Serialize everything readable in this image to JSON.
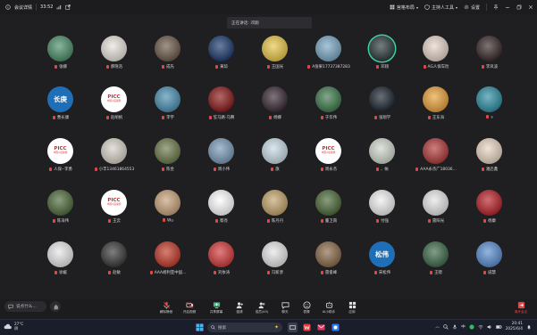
{
  "window": {
    "title": "会议详情",
    "time": "33:52",
    "network_icon": "signal-bars-icon",
    "share_icon": "external-link-icon",
    "view_menu": "宫格布局",
    "host_tools": "主持人工具",
    "settings": "设置"
  },
  "speaking_banner": "正在讲话: 邓翔",
  "participants": [
    {
      "name": "张娜",
      "bg": "#4b8e6a",
      "kind": "photo"
    },
    {
      "name": "郝晓浩",
      "bg": "#e8e3dc",
      "kind": "photo"
    },
    {
      "name": "成先",
      "bg": "#6d5a4a",
      "kind": "photo"
    },
    {
      "name": "黄琼",
      "bg": "#1d3a6e",
      "kind": "photo"
    },
    {
      "name": "王国光",
      "bg": "#e8c74a",
      "kind": "photo"
    },
    {
      "name": "A张果17737387283",
      "bg": "#7aa7c4",
      "kind": "photo"
    },
    {
      "name": "邓翔",
      "bg": "#2c3a3c",
      "kind": "photo",
      "active": true
    },
    {
      "name": "AG人保车险",
      "bg": "#e6d4c8",
      "kind": "photo"
    },
    {
      "name": "李凤波",
      "bg": "#3a2a2a",
      "kind": "photo"
    },
    {
      "name": "曹长康",
      "bg": "#1f6fb8",
      "kind": "text",
      "text": "长庚"
    },
    {
      "name": "赵胡帆",
      "bg": "#ffffff",
      "kind": "logo",
      "text": "PICC",
      "sub": "中国人民保险"
    },
    {
      "name": "李宇",
      "bg": "#4a8fb2",
      "kind": "photo"
    },
    {
      "name": "笙马路-马腾",
      "bg": "#8a1a1a",
      "kind": "photo"
    },
    {
      "name": "杨娜",
      "bg": "#3a2b36",
      "kind": "photo"
    },
    {
      "name": "于华伟",
      "bg": "#3e7a4c",
      "kind": "photo"
    },
    {
      "name": "张翔学",
      "bg": "#1c2430",
      "kind": "photo"
    },
    {
      "name": "王东海",
      "bg": "#e8a23a",
      "kind": "photo"
    },
    {
      "name": "s",
      "bg": "#2e8ea4",
      "kind": "photo"
    },
    {
      "name": "人保--李勇",
      "bg": "#ffffff",
      "kind": "logo",
      "text": "PICC",
      "sub": "中国人民保险"
    },
    {
      "name": "小丰13461864553",
      "bg": "#d8d2c8",
      "kind": "photo"
    },
    {
      "name": "陈金",
      "bg": "#6c7a4c",
      "kind": "photo"
    },
    {
      "name": "周小伟",
      "bg": "#7a9ab8",
      "kind": "photo"
    },
    {
      "name": "旗",
      "bg": "#c8dbe6",
      "kind": "photo"
    },
    {
      "name": "周永杰",
      "bg": "#ffffff",
      "kind": "logo",
      "text": "PICC",
      "sub": "中国人民保险"
    },
    {
      "name": "、帐",
      "bg": "#cfd8cc",
      "kind": "photo"
    },
    {
      "name": "AAA永杰广18036...",
      "bg": "#b23a3a",
      "kind": "photo"
    },
    {
      "name": "潘启鑫",
      "bg": "#e9d6c2",
      "kind": "photo"
    },
    {
      "name": "陈海伟",
      "bg": "#4f6b3c",
      "kind": "photo"
    },
    {
      "name": "王云",
      "bg": "#ffffff",
      "kind": "logo",
      "text": "PICC",
      "sub": "中国人民保险"
    },
    {
      "name": "Wu",
      "bg": "#c8a27a",
      "kind": "photo"
    },
    {
      "name": "蔡亮",
      "bg": "#ffffff",
      "kind": "photo"
    },
    {
      "name": "陈丹丹",
      "bg": "#c4a46c",
      "kind": "photo"
    },
    {
      "name": "董卫南",
      "bg": "#4c6a3a",
      "kind": "photo"
    },
    {
      "name": "付强",
      "bg": "#f0f0f0",
      "kind": "photo"
    },
    {
      "name": "雷阳光",
      "bg": "#e6e6e6",
      "kind": "photo"
    },
    {
      "name": "杨康",
      "bg": "#b8222a",
      "kind": "photo"
    },
    {
      "name": "徐媛",
      "bg": "#e8e8e8",
      "kind": "photo"
    },
    {
      "name": "赵敏",
      "bg": "#3a3a3a",
      "kind": "photo"
    },
    {
      "name": "AAA胡利亚中国...",
      "bg": "#c23a2a",
      "kind": "photo"
    },
    {
      "name": "刘依涛",
      "bg": "#d23a3a",
      "kind": "photo"
    },
    {
      "name": "冯新彦",
      "bg": "#e6e6e6",
      "kind": "photo"
    },
    {
      "name": "雷俊峰",
      "bg": "#8a6a4a",
      "kind": "photo"
    },
    {
      "name": "宋松伟",
      "bg": "#1f6fb8",
      "kind": "text",
      "text": "松伟"
    },
    {
      "name": "王嗯",
      "bg": "#3e6a4a",
      "kind": "photo"
    },
    {
      "name": "戚慧",
      "bg": "#5a8ed0",
      "kind": "photo"
    }
  ],
  "meeting_bar": {
    "chat_placeholder": "说点什么...",
    "tools": [
      {
        "label": "解除静音",
        "icon": "microphone-icon"
      },
      {
        "label": "开启视频",
        "icon": "camera-icon"
      },
      {
        "label": "共享屏幕",
        "icon": "share-screen-icon"
      },
      {
        "label": "邀请",
        "icon": "add-user-icon"
      },
      {
        "label": "成员(45)",
        "icon": "members-icon"
      },
      {
        "label": "聊天",
        "icon": "chat-icon"
      },
      {
        "label": "表情",
        "icon": "emoji-icon"
      },
      {
        "label": "AI小助手",
        "icon": "ai-assistant-icon"
      },
      {
        "label": "应用",
        "icon": "apps-icon"
      }
    ],
    "end": "离开会议"
  },
  "taskbar": {
    "weather_temp": "27°C",
    "weather_desc": "阴",
    "search_placeholder": "搜索",
    "ime": "中",
    "time": "20:41",
    "date": "2025/6/4"
  }
}
